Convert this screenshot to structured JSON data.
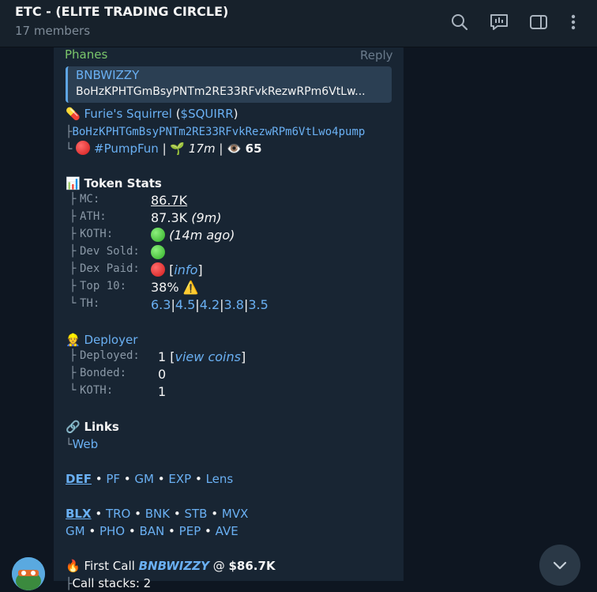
{
  "header": {
    "title": "ETC - (ELITE TRADING CIRCLE)",
    "members": "17 members",
    "icons": [
      "search-icon",
      "poll-icon",
      "sidebar-toggle-icon",
      "more-vertical-icon"
    ]
  },
  "message": {
    "sender": "Phanes",
    "reply_label": "Reply",
    "quote": {
      "name": "BNBWIZZY",
      "text": "BoHzKPHTGmBsyPNTm2RE33RFvkRezwRPm6VtLw..."
    },
    "token": {
      "pill_emoji": "💊",
      "name": "Furie's Squirrel",
      "ticker_open": " (",
      "ticker": "$SQUIRR",
      "ticker_close": ")",
      "address": "BoHzKPHTGmBsyPNTm2RE33RFvkRezwRPm6VtLwo4pump",
      "platform": "#PumpFun",
      "sep1": " | ",
      "age_emoji": "🌱",
      "age": "17m",
      "sep2": " | ",
      "views_emoji": "👁️",
      "views": "65"
    },
    "stats": {
      "emoji": "📊",
      "title": "Token Stats",
      "mc_label": "MC:",
      "mc_value": "86.7K",
      "ath_label": "ATH:",
      "ath_value": "87.3K",
      "ath_time": "(9m)",
      "koth_label": "KOTH:",
      "koth_time": "(14m ago)",
      "dev_sold_label": "Dev Sold:",
      "dex_paid_label": "Dex Paid:",
      "dex_info_open": "[",
      "dex_info": "info",
      "dex_info_close": "]",
      "top10_label": "Top 10:",
      "top10_value": "38%",
      "top10_warning": "⚠️",
      "th_label": "TH:",
      "th_values": [
        "6.3",
        "4.5",
        "4.2",
        "3.8",
        "3.5"
      ],
      "th_sep": "|"
    },
    "deployer": {
      "emoji": "👷",
      "title": "Deployer",
      "deployed_label": "Deployed:",
      "deployed_value": "1",
      "view_coins_open": " [",
      "view_coins": "view coins",
      "view_coins_close": "]",
      "bonded_label": "Bonded:",
      "bonded_value": "0",
      "koth_label": "KOTH:",
      "koth_value": "1"
    },
    "links": {
      "emoji": "🔗",
      "title": "Links",
      "web": "Web"
    },
    "tree": {
      "branch": "├",
      "end": "└"
    },
    "bullet": " • ",
    "def_row": [
      "DEF",
      "PF",
      "GM",
      "EXP",
      "Lens"
    ],
    "blx_row": [
      "BLX",
      "TRO",
      "BNK",
      "STB",
      "MVX"
    ],
    "gm_row": [
      "GM",
      "PHO",
      "BAN",
      "PEP",
      "AVE"
    ],
    "first_call": {
      "emoji": "🔥",
      "label": "First Call",
      "caller": "BNBWIZZY",
      "at": "@",
      "value": "$86.7K",
      "partial": "Call stacks: 2"
    }
  },
  "colors": {
    "background": "#0e1621",
    "bubble": "#182533",
    "link": "#6ab0f3",
    "sender": "#7ac66b"
  }
}
